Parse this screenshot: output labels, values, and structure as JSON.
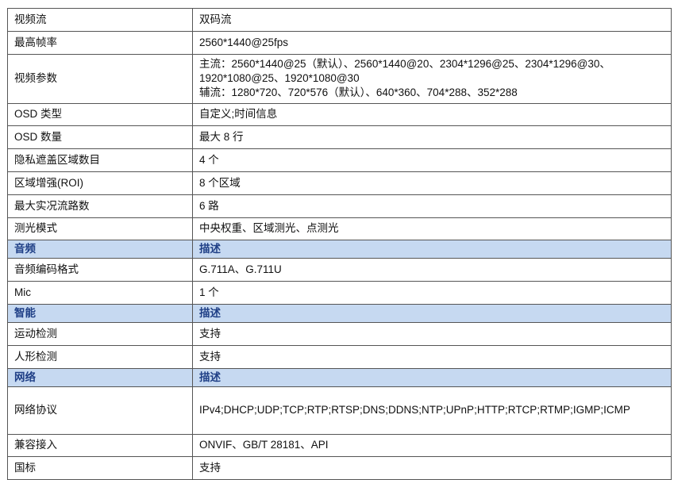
{
  "rows": [
    {
      "type": "row",
      "label": "视频流",
      "value": "双码流"
    },
    {
      "type": "row",
      "label": "最高帧率",
      "value": "2560*1440@25fps"
    },
    {
      "type": "multi",
      "label": "视频参数",
      "lines": [
        "主流：2560*1440@25（默认）、2560*1440@20、2304*1296@25、2304*1296@30、",
        "1920*1080@25、1920*1080@30",
        "辅流：1280*720、720*576（默认）、640*360、704*288、352*288"
      ]
    },
    {
      "type": "row",
      "label": "OSD 类型",
      "value": "自定义;时间信息"
    },
    {
      "type": "row",
      "label": "OSD 数量",
      "value": "最大 8 行"
    },
    {
      "type": "row",
      "label": "隐私遮盖区域数目",
      "value": "4 个"
    },
    {
      "type": "row",
      "label": "区域增强(ROI)",
      "value": "8 个区域"
    },
    {
      "type": "row",
      "label": "最大实况流路数",
      "value": "6 路"
    },
    {
      "type": "row",
      "label": "测光模式",
      "value": "中央权重、区域测光、点测光"
    },
    {
      "type": "section",
      "label": "音频",
      "value": "描述"
    },
    {
      "type": "row",
      "label": "音频编码格式",
      "value": "G.711A、G.711U"
    },
    {
      "type": "row",
      "label": "Mic",
      "value": "1 个"
    },
    {
      "type": "section",
      "label": "智能",
      "value": "描述"
    },
    {
      "type": "row",
      "label": "运动检测",
      "value": "支持"
    },
    {
      "type": "row",
      "label": "人形检测",
      "value": "支持"
    },
    {
      "type": "section",
      "label": "网络",
      "value": "描述"
    },
    {
      "type": "wrap",
      "label": "网络协议",
      "value": "IPv4;DHCP;UDP;TCP;RTP;RTSP;DNS;DDNS;NTP;UPnP;HTTP;RTCP;RTMP;IGMP;ICMP"
    },
    {
      "type": "row",
      "label": "兼容接入",
      "value": "ONVIF、GB/T 28181、API"
    },
    {
      "type": "row",
      "label": "国标",
      "value": "支持"
    }
  ],
  "colors": {
    "section_bg": "#c6d9f1",
    "section_text": "#1f3f86",
    "border": "#555555"
  }
}
